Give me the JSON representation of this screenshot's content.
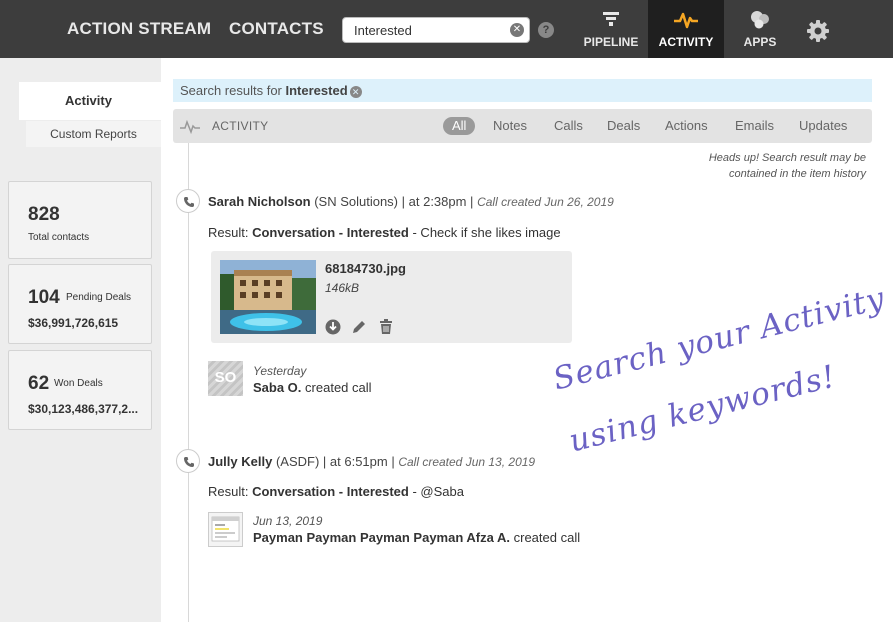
{
  "nav": {
    "action_stream": "ACTION STREAM",
    "contacts": "CONTACTS",
    "search_value": "Interested",
    "help": "?",
    "pipeline": "PIPELINE",
    "activity": "ACTIVITY",
    "apps": "APPS"
  },
  "sidebar": {
    "tabs": [
      {
        "label": "Activity",
        "active": true
      },
      {
        "label": "Custom Reports",
        "active": false
      }
    ],
    "stats": [
      {
        "number": "828",
        "label": "Total contacts",
        "amount": ""
      },
      {
        "number": "104",
        "label": "Pending Deals",
        "amount": "$36,991,726,615"
      },
      {
        "number": "62",
        "label": "Won Deals",
        "amount": "$30,123,486,377,2..."
      }
    ]
  },
  "banner": {
    "prefix": "Search results for",
    "term": "Interested"
  },
  "filter": {
    "title": "ACTIVITY",
    "items": [
      "All",
      "Notes",
      "Calls",
      "Deals",
      "Actions",
      "Emails",
      "Updates"
    ]
  },
  "heads_up": {
    "line1": "Heads up! Search result may be",
    "line2": "contained in the item history"
  },
  "entries": [
    {
      "name": "Sarah Nicholson",
      "company": "(SN Solutions)",
      "time": "| at 2:38pm |",
      "meta": "Call created Jun 26, 2019",
      "result_prefix": "Result:",
      "result_bold": "Conversation - Interested",
      "result_rest": "- Check if she likes image",
      "attachment": {
        "file": "68184730.jpg",
        "size": "146kB"
      },
      "log": {
        "avatar": "SO",
        "time": "Yesterday",
        "actor": "Saba O.",
        "action": "created call"
      }
    },
    {
      "name": "Jully Kelly",
      "company": "(ASDF)",
      "time": "| at 6:51pm |",
      "meta": "Call created Jun 13, 2019",
      "result_prefix": "Result:",
      "result_bold": "Conversation - Interested",
      "result_rest": "- @Saba",
      "log": {
        "time": "Jun 13, 2019",
        "actor": "Payman Payman Payman Payman Afza A.",
        "action": "created call"
      }
    }
  ],
  "promo": {
    "line1": "Search your Activity",
    "line2": "using keywords!"
  },
  "colors": {
    "topbar": "#3d3d3d",
    "accent_orange": "#f5a623",
    "banner": "#ddf1fb",
    "promo": "#6b62c4"
  }
}
